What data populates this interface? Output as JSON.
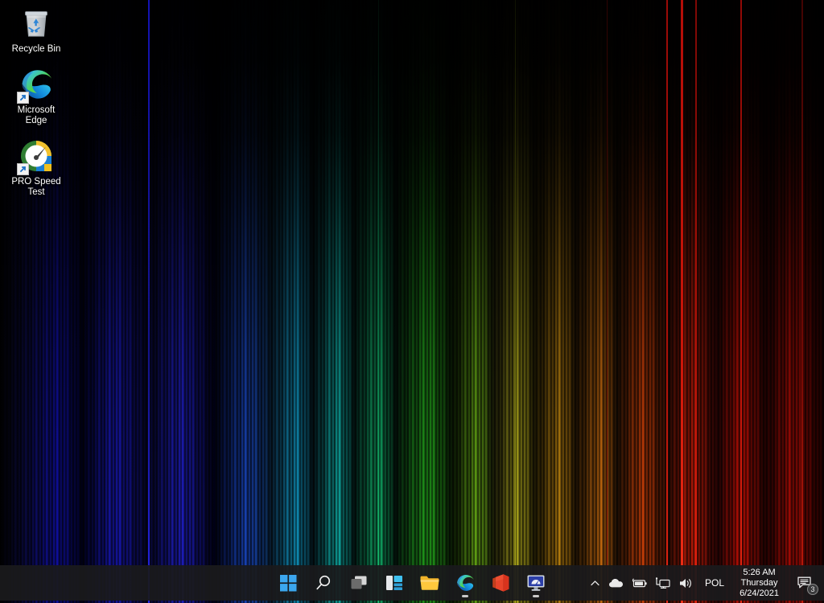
{
  "desktop": {
    "icons": [
      {
        "name": "recycle-bin",
        "label": "Recycle Bin",
        "icon": "recycle-bin-icon",
        "shortcut": false
      },
      {
        "name": "microsoft-edge",
        "label": "Microsoft Edge",
        "icon": "edge-icon",
        "shortcut": true
      },
      {
        "name": "pro-speed-test",
        "label": "PRO Speed Test",
        "icon": "speedometer-icon",
        "shortcut": true
      }
    ]
  },
  "taskbar": {
    "buttons": [
      {
        "name": "start",
        "label": "Start",
        "icon": "windows-logo-icon",
        "active": false
      },
      {
        "name": "search",
        "label": "Search",
        "icon": "search-icon",
        "active": false
      },
      {
        "name": "task-view",
        "label": "Task View",
        "icon": "task-view-icon",
        "active": false
      },
      {
        "name": "widgets",
        "label": "Widgets",
        "icon": "widgets-icon",
        "active": false
      },
      {
        "name": "file-explorer",
        "label": "File Explorer",
        "icon": "folder-icon",
        "active": false
      },
      {
        "name": "microsoft-edge",
        "label": "Microsoft Edge",
        "icon": "edge-icon",
        "active": true
      },
      {
        "name": "microsoft-office",
        "label": "Office",
        "icon": "office-icon",
        "active": false
      },
      {
        "name": "pro-speed-test",
        "label": "PRO Speed Test",
        "icon": "monitor-icon",
        "active": true
      }
    ],
    "tray": {
      "overflow": {
        "name": "show-hidden-icons",
        "label": "Show hidden icons",
        "icon": "chevron-up-icon"
      },
      "icons": [
        {
          "name": "onedrive",
          "label": "OneDrive",
          "icon": "cloud-icon"
        },
        {
          "name": "battery",
          "label": "Battery",
          "icon": "battery-icon"
        },
        {
          "name": "network",
          "label": "Network",
          "icon": "network-monitor-icon"
        },
        {
          "name": "volume",
          "label": "Volume",
          "icon": "speaker-icon"
        }
      ],
      "language": "POL",
      "clock": {
        "time": "5:26 AM",
        "day": "Thursday",
        "date": "6/24/2021"
      },
      "notifications": {
        "icon": "chat-bubble-icon",
        "count": "3"
      }
    }
  },
  "colors": {
    "taskbar_bg": "#1a1a1c",
    "accent_blue": "#0078d4",
    "text": "#ffffff",
    "edge_blue": "#0f7bbd",
    "edge_green": "#4ec94e",
    "folder_yellow": "#ffc83d",
    "office_red": "#d83b01"
  }
}
